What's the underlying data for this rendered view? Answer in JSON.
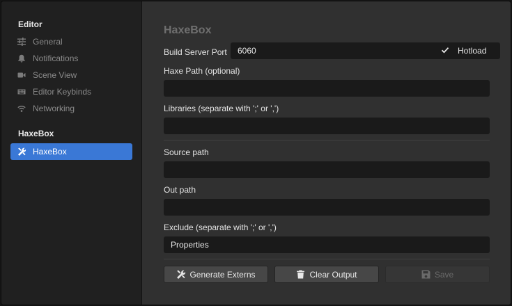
{
  "sidebar": {
    "editor_title": "Editor",
    "editor_items": [
      {
        "label": "General",
        "icon": "sliders-icon"
      },
      {
        "label": "Notifications",
        "icon": "bell-icon"
      },
      {
        "label": "Scene View",
        "icon": "camera-icon"
      },
      {
        "label": "Editor Keybinds",
        "icon": "keyboard-icon"
      },
      {
        "label": "Networking",
        "icon": "wifi-icon"
      }
    ],
    "haxebox_title": "HaxeBox",
    "haxebox_items": [
      {
        "label": "HaxeBox",
        "icon": "tools-icon",
        "active": true
      }
    ],
    "accent": "#3a78d6"
  },
  "main": {
    "heading": "HaxeBox",
    "build_port_label": "Build Server Port",
    "build_port_value": "6060",
    "hotload_label": "Hotload",
    "hotload_checked": true,
    "haxe_path_label": "Haxe Path (optional)",
    "haxe_path_value": "",
    "libraries_label": "Libraries (separate with ';' or ',')",
    "libraries_value": "",
    "source_path_label": "Source path",
    "source_path_value": "",
    "out_path_label": "Out path",
    "out_path_value": "",
    "exclude_label": "Exclude (separate with ';' or ',')",
    "exclude_value": "Properties"
  },
  "buttons": {
    "generate_externs": "Generate Externs",
    "clear_output": "Clear Output",
    "save": "Save"
  }
}
